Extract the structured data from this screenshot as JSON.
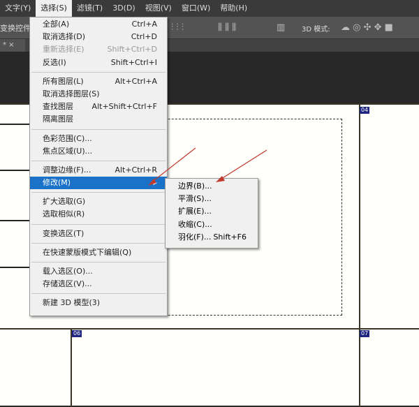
{
  "menubar": [
    "文字(Y)",
    "选择(S)",
    "滤镜(T)",
    "3D(D)",
    "视图(V)",
    "窗口(W)",
    "帮助(H)"
  ],
  "optbar": {
    "label": "变换控件",
    "mode_3d": "3D 模式:"
  },
  "tab": {
    "close": "* ×"
  },
  "canvas": {
    "tags": [
      "04",
      "06",
      "07"
    ]
  },
  "menu": {
    "groups": [
      [
        {
          "label": "全部(A)",
          "shortcut": "Ctrl+A"
        },
        {
          "label": "取消选择(D)",
          "shortcut": "Ctrl+D"
        },
        {
          "label": "重新选择(E)",
          "shortcut": "Shift+Ctrl+D",
          "disabled": true
        },
        {
          "label": "反选(I)",
          "shortcut": "Shift+Ctrl+I"
        }
      ],
      [
        {
          "label": "所有图层(L)",
          "shortcut": "Alt+Ctrl+A"
        },
        {
          "label": "取消选择图层(S)",
          "shortcut": ""
        },
        {
          "label": "查找图层",
          "shortcut": "Alt+Shift+Ctrl+F"
        },
        {
          "label": "隔离图层",
          "shortcut": ""
        }
      ],
      [
        {
          "label": "色彩范围(C)...",
          "shortcut": ""
        },
        {
          "label": "焦点区域(U)...",
          "shortcut": ""
        }
      ],
      [
        {
          "label": "调整边缘(F)...",
          "shortcut": "Alt+Ctrl+R"
        },
        {
          "label": "修改(M)",
          "shortcut": "▸",
          "highlighted": true
        }
      ],
      [
        {
          "label": "扩大选取(G)",
          "shortcut": ""
        },
        {
          "label": "选取相似(R)",
          "shortcut": ""
        }
      ],
      [
        {
          "label": "变换选区(T)",
          "shortcut": ""
        }
      ],
      [
        {
          "label": "在快速蒙版模式下编辑(Q)",
          "shortcut": ""
        }
      ],
      [
        {
          "label": "载入选区(O)...",
          "shortcut": ""
        },
        {
          "label": "存储选区(V)...",
          "shortcut": ""
        }
      ],
      [
        {
          "label": "新建 3D 模型(3)",
          "shortcut": ""
        }
      ]
    ]
  },
  "submenu": [
    {
      "label": "边界(B)...",
      "shortcut": ""
    },
    {
      "label": "平滑(S)...",
      "shortcut": ""
    },
    {
      "label": "扩展(E)...",
      "shortcut": ""
    },
    {
      "label": "收缩(C)...",
      "shortcut": ""
    },
    {
      "label": "羽化(F)...",
      "shortcut": "Shift+F6"
    }
  ],
  "colors": {
    "highlight": "#1a73c8",
    "arrow": "#c0392b",
    "tag": "#1d2580"
  }
}
